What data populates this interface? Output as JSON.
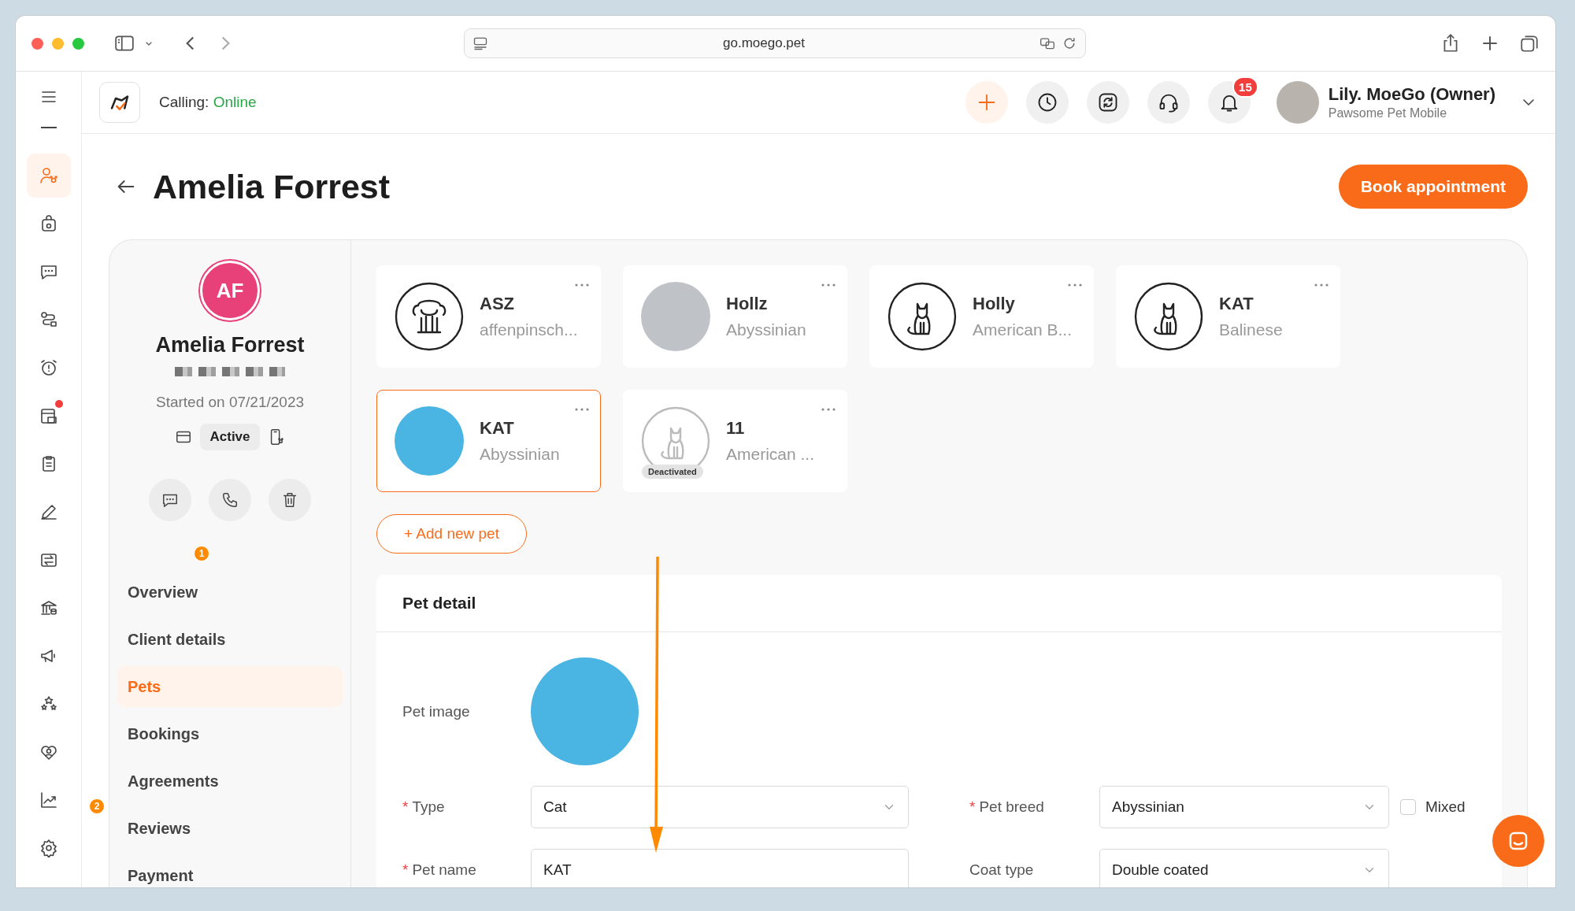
{
  "browser": {
    "url": "go.moego.pet"
  },
  "header": {
    "calling_label": "Calling:",
    "calling_status": "Online",
    "notification_count": "15",
    "user_name": "Lily. MoeGo (Owner)",
    "business": "Pawsome Pet Mobile"
  },
  "rail": [
    {
      "kind": "client",
      "selected": true,
      "dot": false
    },
    {
      "kind": "bag",
      "selected": false,
      "dot": false
    },
    {
      "kind": "chat",
      "selected": false,
      "dot": false
    },
    {
      "kind": "route",
      "selected": false,
      "dot": false
    },
    {
      "kind": "alarm",
      "selected": false,
      "dot": false
    },
    {
      "kind": "store",
      "selected": false,
      "dot": true
    },
    {
      "kind": "clipboard",
      "selected": false,
      "dot": false
    },
    {
      "kind": "pencil",
      "selected": false,
      "dot": false
    },
    {
      "kind": "transfer",
      "selected": false,
      "dot": false
    },
    {
      "kind": "bank",
      "selected": false,
      "dot": false
    },
    {
      "kind": "megaphone",
      "selected": false,
      "dot": false
    },
    {
      "kind": "stars",
      "selected": false,
      "dot": false
    },
    {
      "kind": "heart",
      "selected": false,
      "dot": false
    },
    {
      "kind": "chart",
      "selected": false,
      "dot": false
    },
    {
      "kind": "settings",
      "selected": false,
      "dot": false
    }
  ],
  "page": {
    "title": "Amelia Forrest",
    "book_button": "Book appointment"
  },
  "client": {
    "initials": "AF",
    "name": "Amelia Forrest",
    "started": "Started on 07/21/2023",
    "status": "Active"
  },
  "step_badges": [
    "1",
    "2"
  ],
  "nav": [
    {
      "label": "Overview",
      "selected": false
    },
    {
      "label": "Client details",
      "selected": false
    },
    {
      "label": "Pets",
      "selected": true
    },
    {
      "label": "Bookings",
      "selected": false
    },
    {
      "label": "Agreements",
      "selected": false
    },
    {
      "label": "Reviews",
      "selected": false
    },
    {
      "label": "Payment",
      "selected": false
    }
  ],
  "pets": [
    {
      "name": "ASZ",
      "breed": "affenpinsch...",
      "kind": "dog",
      "selected": false
    },
    {
      "name": "Hollz",
      "breed": "Abyssinian",
      "kind": "photo",
      "selected": false
    },
    {
      "name": "Holly",
      "breed": "American B...",
      "kind": "cat",
      "selected": false
    },
    {
      "name": "KAT",
      "breed": "Balinese",
      "kind": "cat",
      "selected": false
    },
    {
      "name": "KAT",
      "breed": "Abyssinian",
      "kind": "photo",
      "selected": true
    },
    {
      "name": "11",
      "breed": "American ...",
      "kind": "cat",
      "selected": false,
      "badge": "Deactivated"
    }
  ],
  "add_pet": "+ Add new pet",
  "pet_detail": {
    "title": "Pet detail",
    "image_label": "Pet image",
    "fields": [
      {
        "label": "Type",
        "required_mark": "*",
        "value": "Cat",
        "kind": "select"
      },
      {
        "label": "Pet breed",
        "required_mark": "*",
        "value": "Abyssinian",
        "kind": "select",
        "mixed": {
          "label": "Mixed",
          "checked": false
        }
      },
      {
        "label": "Pet name",
        "required_mark": "*",
        "value": "KAT",
        "kind": "text"
      },
      {
        "label": "Coat type",
        "value": "Double coated",
        "kind": "select"
      }
    ]
  }
}
